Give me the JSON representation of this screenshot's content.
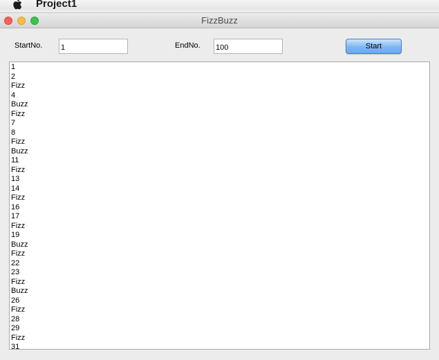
{
  "menubar": {
    "apple_icon": "apple-icon",
    "app_name": "Project1"
  },
  "window": {
    "title": "FizzBuzz"
  },
  "form": {
    "start_label": "StartNo.",
    "start_value": "1",
    "end_label": "EndNo.",
    "end_value": "100",
    "start_button_label": "Start"
  },
  "output": {
    "lines": [
      "1",
      "2",
      "Fizz",
      "4",
      "Buzz",
      "Fizz",
      "7",
      "8",
      "Fizz",
      "Buzz",
      "11",
      "Fizz",
      "13",
      "14",
      "Fizz",
      "16",
      "17",
      "Fizz",
      "19",
      "Buzz",
      "Fizz",
      "22",
      "23",
      "Fizz",
      "Buzz",
      "26",
      "Fizz",
      "28",
      "29",
      "Fizz",
      "31"
    ]
  },
  "colors": {
    "close": "#fc605b",
    "minimize": "#fdbc40",
    "maximize": "#34c84a",
    "button_accent": "#6aaaf0"
  }
}
